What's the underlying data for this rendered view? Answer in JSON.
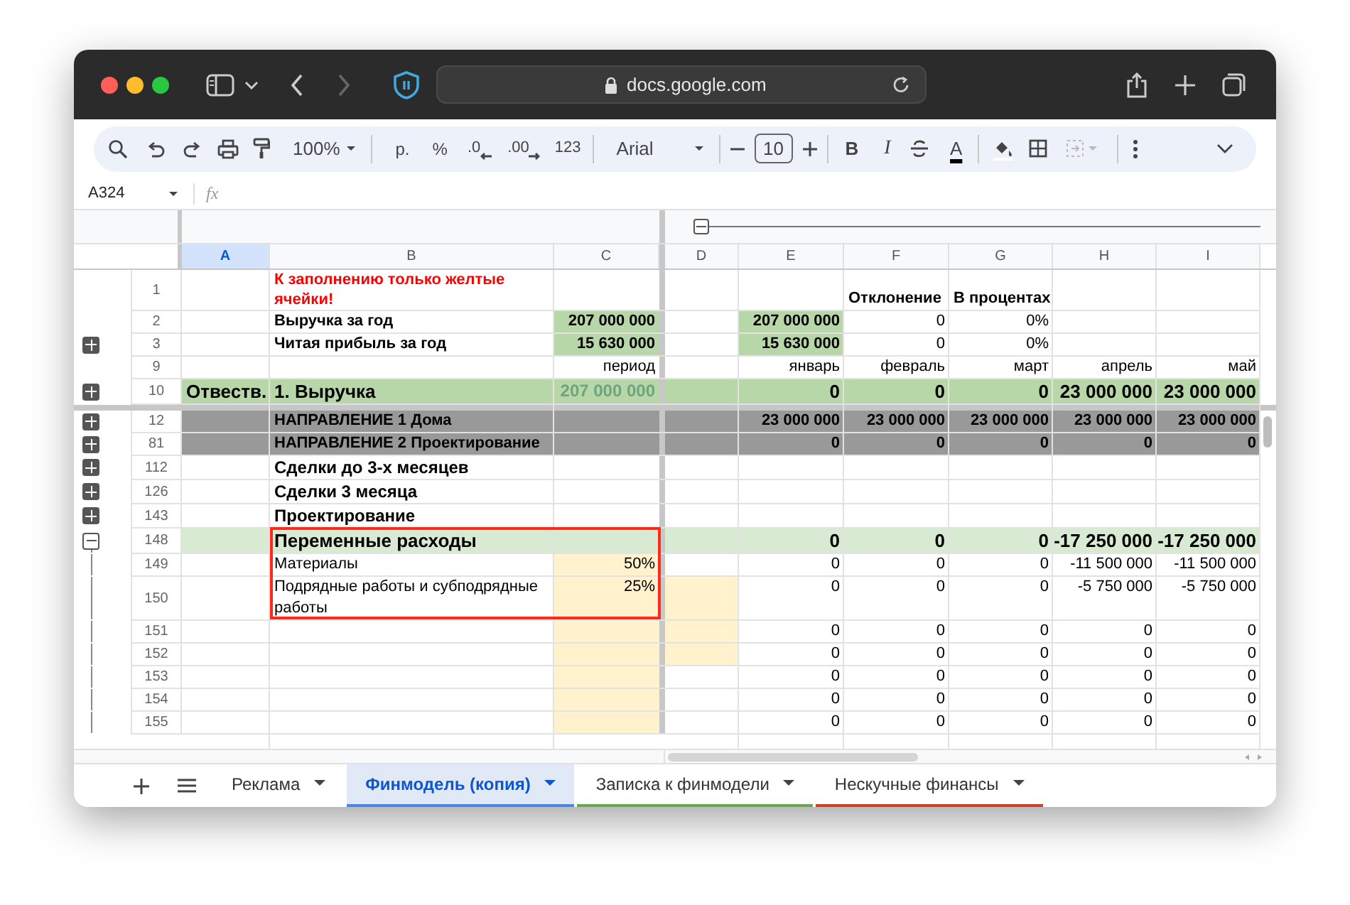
{
  "browser": {
    "url": "docs.google.com"
  },
  "toolbar": {
    "zoom": "100%",
    "currency": "р.",
    "percent": "%",
    "decrease_decimals": ".0",
    "increase_decimals": ".00",
    "number_format": "123",
    "font": "Arial",
    "font_size": "10",
    "bold": "B",
    "italic": "I",
    "text_color": "A"
  },
  "formula_bar": {
    "name_box": "A324",
    "label": "fx"
  },
  "columns": [
    {
      "label": "A",
      "selected": true
    },
    {
      "label": "B",
      "selected": false
    },
    {
      "label": "C",
      "selected": false
    },
    {
      "label": "D",
      "selected": false
    },
    {
      "label": "E",
      "selected": false
    },
    {
      "label": "F",
      "selected": false
    },
    {
      "label": "G",
      "selected": false
    },
    {
      "label": "H",
      "selected": false
    },
    {
      "label": "I",
      "selected": false
    }
  ],
  "rows": [
    {
      "number": "1",
      "cells": [
        {},
        {
          "text": "К заполнению только желтые ячейки!",
          "kind": "note"
        },
        {},
        {},
        {},
        {
          "text": "Отклонение",
          "kind": "caption"
        },
        {
          "text": "В процентах",
          "kind": "caption"
        },
        {},
        {}
      ]
    },
    {
      "number": "2",
      "cells": [
        {},
        {
          "text": "Выручка за год",
          "kind": "label"
        },
        {
          "text": "207 000 000",
          "kind": "total"
        },
        {},
        {
          "text": "207 000 000",
          "kind": "total"
        },
        {
          "text": "0"
        },
        {
          "text": "0%"
        },
        {},
        {}
      ]
    },
    {
      "number": "3",
      "expanded": false,
      "cells": [
        {},
        {
          "text": "Читая прибыль за год",
          "kind": "label"
        },
        {
          "text": "15 630 000",
          "kind": "total"
        },
        {},
        {
          "text": "15 630 000",
          "kind": "total"
        },
        {
          "text": "0"
        },
        {
          "text": "0%"
        },
        {},
        {}
      ]
    },
    {
      "number": "9",
      "cells": [
        {},
        {},
        {
          "text": "период"
        },
        {},
        {
          "text": "январь"
        },
        {
          "text": "февраль"
        },
        {
          "text": "март"
        },
        {
          "text": "апрель"
        },
        {
          "text": "май"
        }
      ]
    },
    {
      "number": "10",
      "expanded": false,
      "kind": "revenue",
      "cells": [
        {
          "text": "Отвеств.",
          "kind": "header"
        },
        {
          "text": "1. Выручка",
          "kind": "header"
        },
        {
          "text": "207 000 000",
          "kind": "muted"
        },
        {},
        {
          "text": "0",
          "kind": "header"
        },
        {
          "text": "0",
          "kind": "header"
        },
        {
          "text": "0",
          "kind": "header"
        },
        {
          "text": "23 000 000",
          "kind": "header"
        },
        {
          "text": "23 000 000",
          "kind": "header"
        }
      ]
    },
    {
      "number": "12",
      "expanded": false,
      "kind": "direction",
      "cells": [
        {},
        {
          "text": "НАПРАВЛЕНИЕ 1 Дома",
          "kind": "label"
        },
        {},
        {},
        {
          "text": "23 000 000",
          "kind": "label"
        },
        {
          "text": "23 000 000",
          "kind": "label"
        },
        {
          "text": "23 000 000",
          "kind": "label"
        },
        {
          "text": "23 000 000",
          "kind": "label"
        },
        {
          "text": "23 000 000",
          "kind": "label"
        }
      ]
    },
    {
      "number": "81",
      "expanded": false,
      "kind": "direction",
      "cells": [
        {},
        {
          "text": "НАПРАВЛЕНИЕ 2 Проектирование",
          "kind": "label"
        },
        {},
        {},
        {
          "text": "0",
          "kind": "label"
        },
        {
          "text": "0",
          "kind": "label"
        },
        {
          "text": "0",
          "kind": "label"
        },
        {
          "text": "0",
          "kind": "label"
        },
        {
          "text": "0",
          "kind": "label"
        }
      ]
    },
    {
      "number": "112",
      "expanded": false,
      "cells": [
        {},
        {
          "text": "Сделки до 3-х месяцев",
          "kind": "section"
        },
        {},
        {},
        {},
        {},
        {},
        {},
        {}
      ]
    },
    {
      "number": "126",
      "expanded": false,
      "cells": [
        {},
        {
          "text": "Сделки 3 месяца",
          "kind": "section"
        },
        {},
        {},
        {},
        {},
        {},
        {},
        {}
      ]
    },
    {
      "number": "143",
      "expanded": false,
      "cells": [
        {},
        {
          "text": "Проектирование",
          "kind": "section"
        },
        {},
        {},
        {},
        {},
        {},
        {},
        {}
      ]
    },
    {
      "number": "148",
      "expanded": true,
      "kind": "expense",
      "cells": [
        {},
        {
          "text": "Переменные расходы",
          "kind": "header"
        },
        {},
        {},
        {
          "text": "0",
          "kind": "header"
        },
        {
          "text": "0",
          "kind": "header"
        },
        {
          "text": "0",
          "kind": "header"
        },
        {
          "text": "-17 250 000",
          "kind": "header"
        },
        {
          "text": "-17 250 000",
          "kind": "header"
        }
      ]
    },
    {
      "number": "149",
      "cells": [
        {},
        {
          "text": "Материалы"
        },
        {
          "text": "50%",
          "kind": "input"
        },
        {},
        {
          "text": "0"
        },
        {
          "text": "0"
        },
        {
          "text": "0"
        },
        {
          "text": "-11 500 000"
        },
        {
          "text": "-11 500 000"
        }
      ]
    },
    {
      "number": "150",
      "cells": [
        {},
        {
          "text": "Подрядные работы и субподрядные работы"
        },
        {
          "text": "25%",
          "kind": "input"
        },
        {
          "kind": "input"
        },
        {
          "text": "0"
        },
        {
          "text": "0"
        },
        {
          "text": "0"
        },
        {
          "text": "-5 750 000"
        },
        {
          "text": "-5 750 000"
        }
      ]
    },
    {
      "number": "151",
      "cells": [
        {},
        {},
        {
          "kind": "input"
        },
        {
          "kind": "input"
        },
        {
          "text": "0"
        },
        {
          "text": "0"
        },
        {
          "text": "0"
        },
        {
          "text": "0"
        },
        {
          "text": "0"
        }
      ]
    },
    {
      "number": "152",
      "cells": [
        {},
        {},
        {
          "kind": "input"
        },
        {
          "kind": "input"
        },
        {
          "text": "0"
        },
        {
          "text": "0"
        },
        {
          "text": "0"
        },
        {
          "text": "0"
        },
        {
          "text": "0"
        }
      ]
    },
    {
      "number": "153",
      "cells": [
        {},
        {},
        {
          "kind": "input"
        },
        {},
        {
          "text": "0"
        },
        {
          "text": "0"
        },
        {
          "text": "0"
        },
        {
          "text": "0"
        },
        {
          "text": "0"
        }
      ]
    },
    {
      "number": "154",
      "cells": [
        {},
        {},
        {
          "kind": "input"
        },
        {},
        {
          "text": "0"
        },
        {
          "text": "0"
        },
        {
          "text": "0"
        },
        {
          "text": "0"
        },
        {
          "text": "0"
        }
      ]
    },
    {
      "number": "155",
      "cells": [
        {},
        {},
        {
          "kind": "input"
        },
        {},
        {
          "text": "0"
        },
        {
          "text": "0"
        },
        {
          "text": "0"
        },
        {
          "text": "0"
        },
        {
          "text": "0"
        }
      ]
    }
  ],
  "sheets": [
    {
      "label": "Реклама",
      "selected": false
    },
    {
      "label": "Финмодель (копия)",
      "selected": true,
      "color": "#4a86e8"
    },
    {
      "label": "Записка к финмодели",
      "selected": false,
      "color": "#6aa84f"
    },
    {
      "label": "Нескучные финансы",
      "selected": false,
      "color": "#cc4125"
    }
  ]
}
